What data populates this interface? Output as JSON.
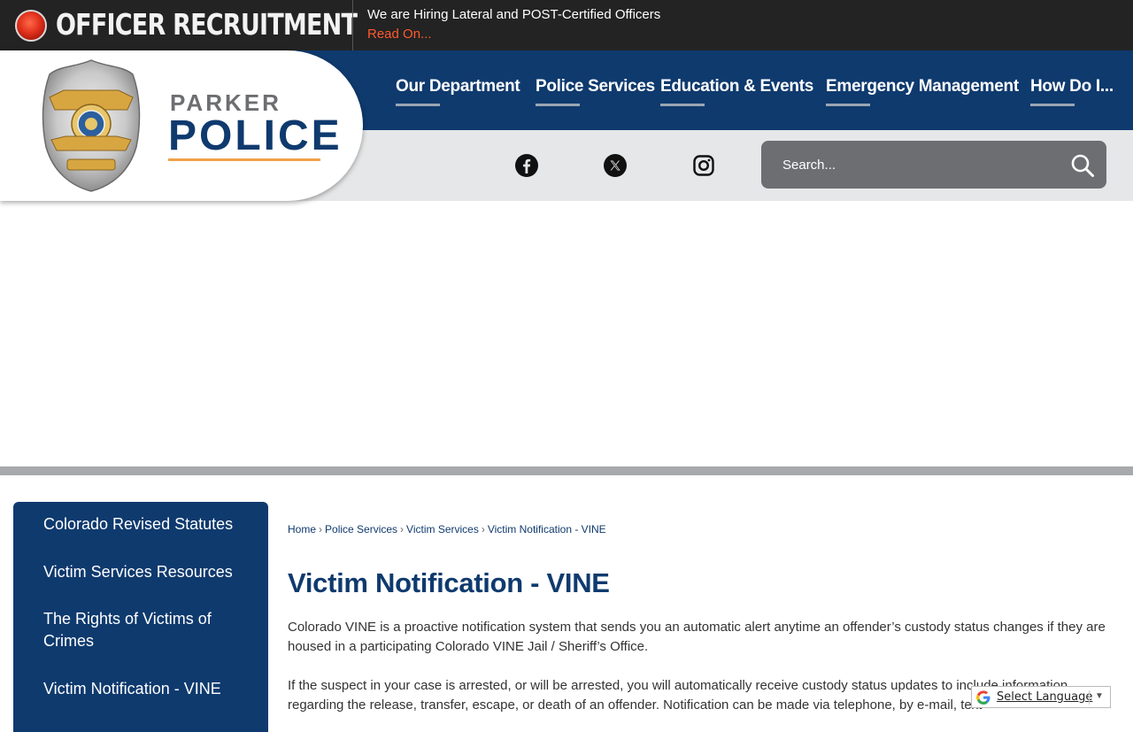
{
  "alert": {
    "title": "OFFICER RECRUITMENT",
    "message": "We are Hiring Lateral and POST-Certified Officers",
    "link": "Read On..."
  },
  "logo": {
    "line1": "PARKER",
    "line2": "POLICE",
    "badge_icon": "police-badge-icon"
  },
  "nav": {
    "items": [
      {
        "label": "Our Department"
      },
      {
        "label": "Police Services"
      },
      {
        "label": "Education & Events"
      },
      {
        "label": "Emergency Management"
      },
      {
        "label": "How Do I..."
      }
    ]
  },
  "social": [
    "facebook-icon",
    "x-twitter-icon",
    "instagram-icon"
  ],
  "search": {
    "placeholder": "Search..."
  },
  "sidebar": {
    "items": [
      {
        "label": "Colorado Revised Statutes"
      },
      {
        "label": "Victim Services Resources"
      },
      {
        "label": "The Rights of Victims of Crimes"
      },
      {
        "label": "Victim Notification - VINE"
      }
    ]
  },
  "breadcrumb": [
    "Home",
    "Police Services",
    "Victim Services",
    "Victim Notification - VINE"
  ],
  "page": {
    "title": "Victim Notification - VINE",
    "paragraphs": [
      "Colorado VINE is a proactive notification system that sends you an automatic alert anytime an offender’s custody status changes if they are housed in a participating Colorado VINE Jail / Sheriff’s Office.",
      "If the suspect in your case is arrested, or will be arrested, you will automatically receive custody status updates to include information regarding the release, transfer, escape, or death of an offender. Notification can be made via telephone, by e-mail, text"
    ]
  },
  "translate": {
    "label": "Select Language"
  },
  "colors": {
    "brand_navy": "#0f3a6e",
    "alert_bg": "#232323",
    "alert_link": "#ff5a2e",
    "accent_gold": "#f0a24a"
  }
}
